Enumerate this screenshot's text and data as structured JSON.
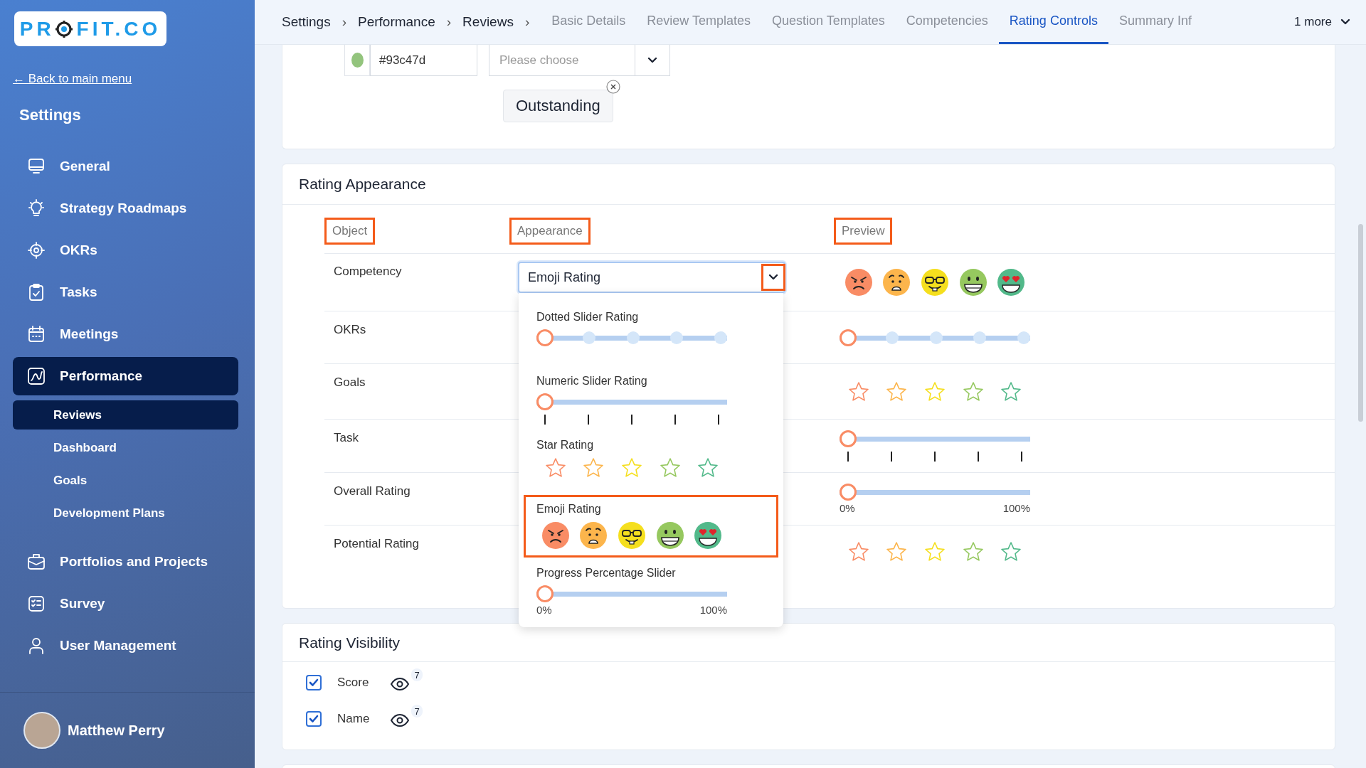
{
  "sidebar": {
    "logo": {
      "before": "PR",
      "after": "FIT.CO"
    },
    "back_link": "← Back to main menu",
    "title": "Settings",
    "items": [
      {
        "label": "General",
        "selected": false
      },
      {
        "label": "Strategy Roadmaps",
        "selected": false
      },
      {
        "label": "OKRs",
        "selected": false
      },
      {
        "label": "Tasks",
        "selected": false
      },
      {
        "label": "Meetings",
        "selected": false
      },
      {
        "label": "Performance",
        "selected": true,
        "expanded": true,
        "children": [
          {
            "label": "Reviews",
            "selected": true
          },
          {
            "label": "Dashboard",
            "selected": false
          },
          {
            "label": "Goals",
            "selected": false
          },
          {
            "label": "Development Plans",
            "selected": false
          }
        ]
      },
      {
        "label": "Portfolios and Projects",
        "selected": false
      },
      {
        "label": "Survey",
        "selected": false
      },
      {
        "label": "User Management",
        "selected": false
      }
    ],
    "user": {
      "name": "Matthew Perry"
    }
  },
  "breadcrumbs": [
    {
      "label": "Settings",
      "separator": "›"
    },
    {
      "label": "Performance",
      "separator": "›"
    },
    {
      "label": "Reviews",
      "separator": "›"
    }
  ],
  "tabs": [
    {
      "label": "Basic Details",
      "selected": false
    },
    {
      "label": "Review Templates",
      "selected": false
    },
    {
      "label": "Question Templates",
      "selected": false
    },
    {
      "label": "Competencies",
      "selected": false
    },
    {
      "label": "Rating Controls",
      "selected": true
    },
    {
      "label": "Summary Inf",
      "selected": false
    }
  ],
  "more_tabs": "1 more",
  "level_editor": {
    "color_value": "#93c47d",
    "select": {
      "placeholder": "Please choose"
    },
    "chips": [
      {
        "label": "Outstanding"
      }
    ]
  },
  "rating_appearance": {
    "title": "Rating Appearance",
    "columns": [
      {
        "label": "Object",
        "highlighted": true
      },
      {
        "label": "Appearance",
        "highlighted": true
      },
      {
        "label": "Preview",
        "highlighted": true
      }
    ],
    "select": {
      "value": "Emoji Rating",
      "open": true,
      "toggle_highlighted": true,
      "options": [
        {
          "label": "Dotted Slider Rating",
          "kind": "dotted_slider",
          "level": 0,
          "highlighted": false
        },
        {
          "label": "Numeric Slider Rating",
          "kind": "numeric_slider",
          "level": 0,
          "highlighted": false
        },
        {
          "label": "Star Rating",
          "kind": "stars",
          "stars": 0,
          "highlighted": false
        },
        {
          "label": "Emoji Rating",
          "kind": "emoji",
          "highlighted": true
        },
        {
          "label": "Progress Percentage Slider",
          "kind": "percent_slider",
          "level": 0,
          "min_label": "0%",
          "max_label": "100%",
          "highlighted": false
        }
      ]
    },
    "rows": [
      {
        "object": "Competency",
        "preview": {
          "kind": "emoji"
        }
      },
      {
        "object": "OKRs",
        "preview": {
          "kind": "dotted_slider",
          "level": 0
        }
      },
      {
        "object": "Goals",
        "preview": {
          "kind": "stars",
          "stars": 0
        }
      },
      {
        "object": "Task",
        "preview": {
          "kind": "numeric_slider",
          "level": 0
        }
      },
      {
        "object": "Overall Rating",
        "preview": {
          "kind": "percent_slider",
          "level": 0,
          "min_label": "0%",
          "max_label": "100%"
        }
      },
      {
        "object": "Potential Rating",
        "preview": {
          "kind": "stars",
          "stars": 0
        }
      }
    ]
  },
  "rating_visibility": {
    "title": "Rating Visibility",
    "items": [
      {
        "label": "Score",
        "checked": true,
        "badge": "7"
      },
      {
        "label": "Name",
        "checked": true,
        "badge": "7"
      }
    ]
  }
}
